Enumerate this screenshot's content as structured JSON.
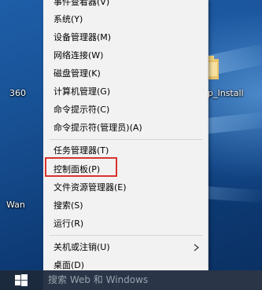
{
  "desktop": {
    "icon_labels": {
      "left_360": "360",
      "right_install": "p_Install",
      "left_wan": "Wan"
    }
  },
  "context_menu": {
    "items": [
      {
        "label": "事件查看器(V)"
      },
      {
        "label": "系统(Y)"
      },
      {
        "label": "设备管理器(M)"
      },
      {
        "label": "网络连接(W)"
      },
      {
        "label": "磁盘管理(K)"
      },
      {
        "label": "计算机管理(G)"
      },
      {
        "label": "命令提示符(C)"
      },
      {
        "label": "命令提示符(管理员)(A)"
      },
      {
        "label": "任务管理器(T)"
      },
      {
        "label": "控制面板(P)"
      },
      {
        "label": "文件资源管理器(E)"
      },
      {
        "label": "搜索(S)"
      },
      {
        "label": "运行(R)"
      },
      {
        "label": "关机或注销(U)"
      },
      {
        "label": "桌面(D)"
      }
    ],
    "highlight_color": "#d9322e",
    "submenu_arrow_icon": "chevron-right-icon"
  },
  "taskbar": {
    "search_placeholder": "搜索 Web 和 Windows",
    "start_icon": "windows-logo-icon"
  }
}
